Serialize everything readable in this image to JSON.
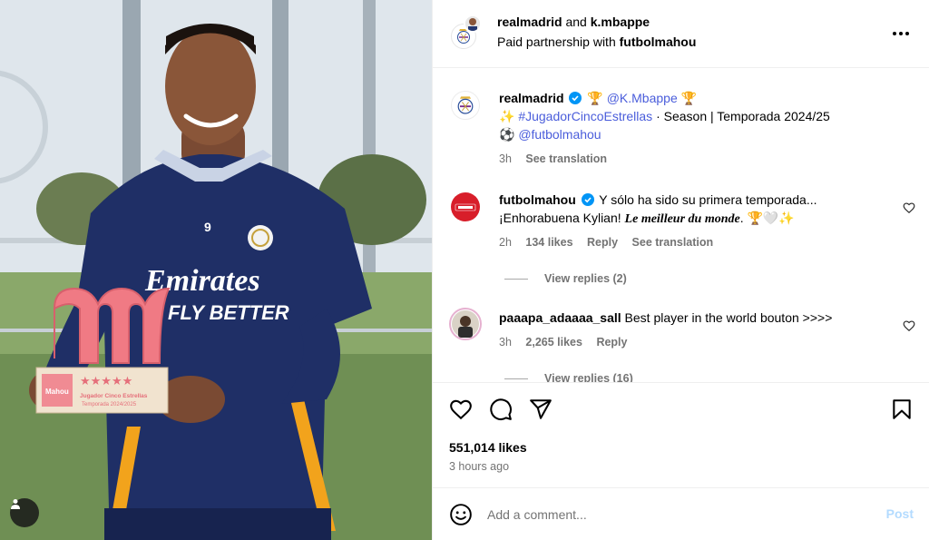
{
  "header": {
    "account1": "realmadrid",
    "and_word": "and",
    "account2": "k.mbappe",
    "partner_prefix": "Paid partnership with",
    "partner": "futbolmahou"
  },
  "caption": {
    "username": "realmadrid",
    "mention": "@K.Mbappe",
    "hashtag": "#JugadorCincoEstrellas",
    "text": "· Season | Temporada 2024/25",
    "mention2": "@futbolmahou",
    "time": "3h",
    "see_translation": "See translation"
  },
  "comments": [
    {
      "username": "futbolmahou",
      "text_line1": "Y sólo ha sido su primera temporada...",
      "text_line2_plain": "¡Enhorabuena Kylian!",
      "text_line2_styled": "Le meilleur du monde",
      "time": "2h",
      "likes": "134 likes",
      "reply": "Reply",
      "see_translation": "See translation",
      "view_replies": "View replies (2)"
    },
    {
      "username": "paaapa_adaaaa_sall",
      "text": "Best player in the world bouton >>>>",
      "time": "3h",
      "likes": "2,265 likes",
      "reply": "Reply",
      "view_replies": "View replies (16)"
    }
  ],
  "stats": {
    "likes": "551,014 likes",
    "time_ago": "3 hours ago"
  },
  "composer": {
    "placeholder": "Add a comment...",
    "post_label": "Post"
  },
  "photo": {
    "jersey_sponsor_line1": "Emirates",
    "jersey_sponsor_line2": "FLY BETTER",
    "jersey_number": "9",
    "trophy_brand": "Mahou",
    "trophy_line1": "Jugador Cinco Estrellas",
    "trophy_line2": "Temporada 2024/2025"
  },
  "colors": {
    "link": "#00376b",
    "hashtag": "#4a5ddb",
    "verified": "#0095f6",
    "muted": "#737373",
    "post_disabled": "#b3dbff",
    "mahou_red": "#d81e2a"
  },
  "icons": [
    "more-icon",
    "verified-icon",
    "heart-icon",
    "comment-icon",
    "share-icon",
    "bookmark-icon",
    "emoji-icon",
    "user-tag-icon"
  ]
}
